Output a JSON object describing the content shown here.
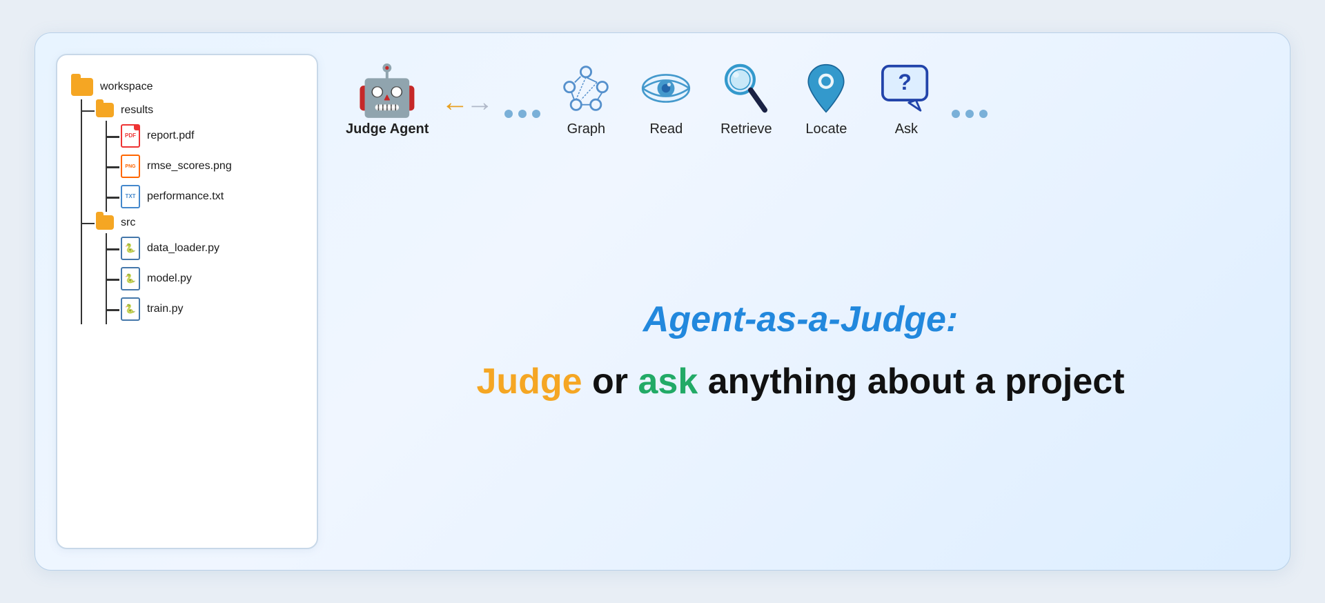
{
  "fileTree": {
    "root": {
      "name": "workspace",
      "children": [
        {
          "name": "results",
          "type": "folder",
          "children": [
            {
              "name": "report.pdf",
              "type": "pdf"
            },
            {
              "name": "rmse_scores.png",
              "type": "png"
            },
            {
              "name": "performance.txt",
              "type": "txt"
            }
          ]
        },
        {
          "name": "src",
          "type": "folder",
          "children": [
            {
              "name": "data_loader.py",
              "type": "py"
            },
            {
              "name": "model.py",
              "type": "py"
            },
            {
              "name": "train.py",
              "type": "py"
            }
          ]
        }
      ]
    }
  },
  "agent": {
    "label": "Judge Agent",
    "emoji": "🤖"
  },
  "tools": [
    {
      "id": "graph",
      "label": "Graph"
    },
    {
      "id": "read",
      "label": "Read"
    },
    {
      "id": "retrieve",
      "label": "Retrieve"
    },
    {
      "id": "locate",
      "label": "Locate"
    },
    {
      "id": "ask",
      "label": "Ask"
    }
  ],
  "headline1": "Agent-as-a-Judge:",
  "headline2_prefix": "Judge",
  "headline2_or": " or ",
  "headline2_ask": "ask",
  "headline2_suffix": " anything about a project",
  "colors": {
    "accent_blue": "#2288dd",
    "accent_orange": "#f5a623",
    "accent_green": "#22aa66",
    "folder": "#f5a623",
    "dot": "#7ab0d8"
  }
}
